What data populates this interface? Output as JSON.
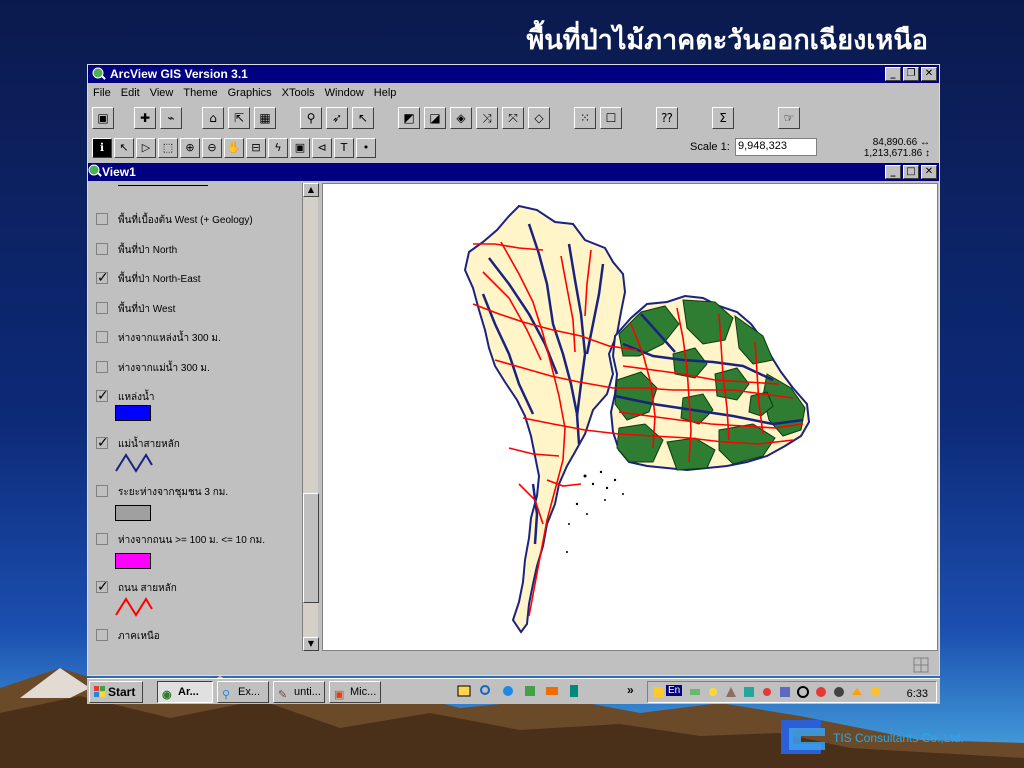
{
  "slide": {
    "title": "พื้นที่ป่าไม้ภาคตะวันออกเฉียงเหนือ",
    "brand": "TIS Consultants Co.,Ltd."
  },
  "app": {
    "title": "ArcView GIS Version 3.1",
    "window_buttons": [
      "_",
      "▫",
      "✕"
    ],
    "menu": [
      "File",
      "Edit",
      "View",
      "Theme",
      "Graphics",
      "XTools",
      "Window",
      "Help"
    ],
    "scale_label": "Scale 1:",
    "scale_value": "9,948,323",
    "coord_x": "84,890.66",
    "coord_y": "1,213,671.86"
  },
  "view": {
    "title": "View1",
    "layers": [
      {
        "label": "พื้นที่เบื้องต้น West (+ Geology)",
        "checked": false
      },
      {
        "label": "พื้นที่ป่า North",
        "checked": false
      },
      {
        "label": "พื้นที่ป่า North-East",
        "checked": true
      },
      {
        "label": "พื้นที่ป่า West",
        "checked": false
      },
      {
        "label": "ห่างจากแหล่งน้ำ 300 ม.",
        "checked": false
      },
      {
        "label": "ห่างจากแม่น้ำ 300 ม.",
        "checked": false
      },
      {
        "label": "แหล่งน้ำ",
        "checked": true,
        "swatch": "#0000ff"
      },
      {
        "label": "แม่น้ำสายหลัก",
        "checked": true,
        "line": "#1a237e"
      },
      {
        "label": "ระยะห่างจากชุมชน 3 กม.",
        "checked": false,
        "swatch": "#a0a0a0"
      },
      {
        "label": "ห่างจากถนน >= 100 ม. <= 10 กม.",
        "checked": false,
        "swatch": "#ff00ff"
      },
      {
        "label": "ถนน สายหลัก",
        "checked": true,
        "line": "#ff0000"
      },
      {
        "label": "ภาคเหนือ",
        "checked": false
      }
    ],
    "colors": {
      "land": "#fff5c8",
      "forest": "#2e7d32",
      "roads": "#ff0000",
      "rivers": "#1a237e"
    }
  },
  "taskbar": {
    "start": "Start",
    "tasks": [
      "Ar...",
      "Ex...",
      "unti...",
      "Mic..."
    ],
    "clock": "6:33",
    "lang": "En"
  }
}
